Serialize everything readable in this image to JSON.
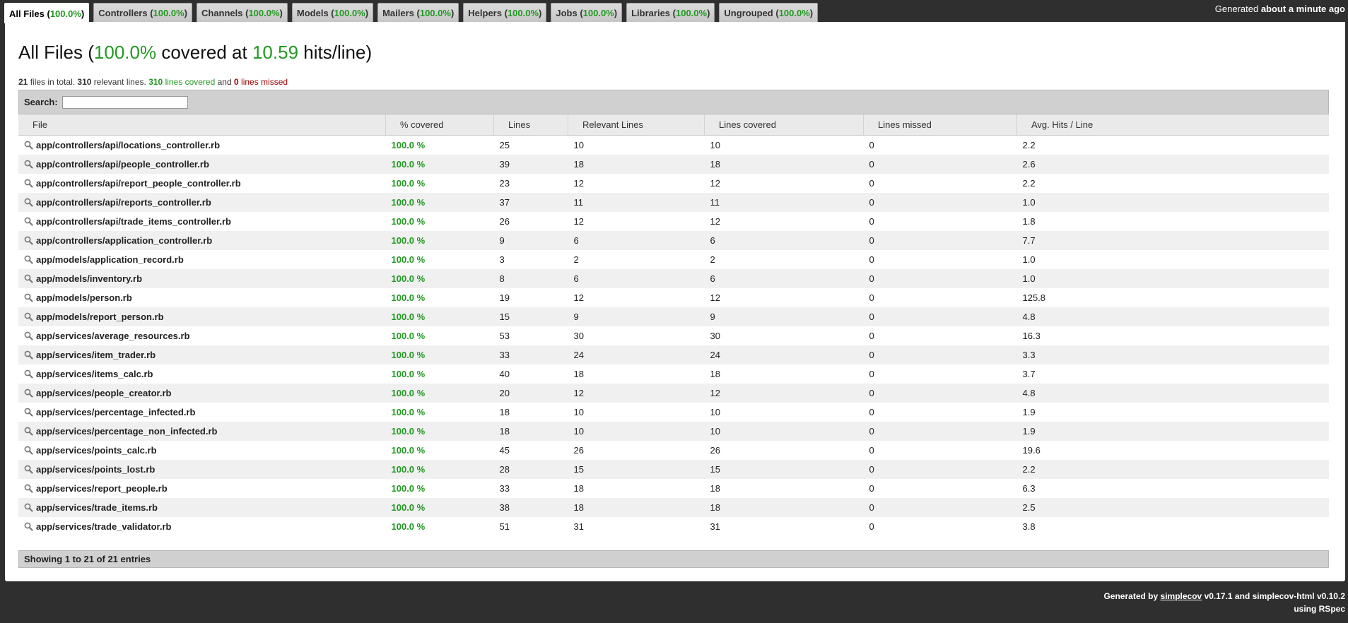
{
  "tabs": [
    {
      "name": "All Files",
      "pct": "100.0%",
      "active": true
    },
    {
      "name": "Controllers",
      "pct": "100.0%"
    },
    {
      "name": "Channels",
      "pct": "100.0%"
    },
    {
      "name": "Models",
      "pct": "100.0%"
    },
    {
      "name": "Mailers",
      "pct": "100.0%"
    },
    {
      "name": "Helpers",
      "pct": "100.0%"
    },
    {
      "name": "Jobs",
      "pct": "100.0%"
    },
    {
      "name": "Libraries",
      "pct": "100.0%"
    },
    {
      "name": "Ungrouped",
      "pct": "100.0%"
    }
  ],
  "timestamp": {
    "prefix": "Generated",
    "value": "about a minute ago"
  },
  "title": {
    "name": "All Files",
    "pct": "100.0%",
    "middle": "covered at",
    "hits": "10.59",
    "suffix": "hits/line"
  },
  "summary": {
    "files": "21",
    "files_text": "files in total.",
    "relevant": "310",
    "relevant_text": "relevant lines.",
    "covered": "310",
    "covered_text": "lines covered",
    "and_text": "and",
    "missed": "0",
    "missed_text": "lines missed"
  },
  "search": {
    "label": "Search:",
    "value": ""
  },
  "table": {
    "headers": [
      "File",
      "% covered",
      "Lines",
      "Relevant Lines",
      "Lines covered",
      "Lines missed",
      "Avg. Hits / Line"
    ],
    "rows": [
      [
        "app/controllers/api/locations_controller.rb",
        "100.0 %",
        "25",
        "10",
        "10",
        "0",
        "2.2"
      ],
      [
        "app/controllers/api/people_controller.rb",
        "100.0 %",
        "39",
        "18",
        "18",
        "0",
        "2.6"
      ],
      [
        "app/controllers/api/report_people_controller.rb",
        "100.0 %",
        "23",
        "12",
        "12",
        "0",
        "2.2"
      ],
      [
        "app/controllers/api/reports_controller.rb",
        "100.0 %",
        "37",
        "11",
        "11",
        "0",
        "1.0"
      ],
      [
        "app/controllers/api/trade_items_controller.rb",
        "100.0 %",
        "26",
        "12",
        "12",
        "0",
        "1.8"
      ],
      [
        "app/controllers/application_controller.rb",
        "100.0 %",
        "9",
        "6",
        "6",
        "0",
        "7.7"
      ],
      [
        "app/models/application_record.rb",
        "100.0 %",
        "3",
        "2",
        "2",
        "0",
        "1.0"
      ],
      [
        "app/models/inventory.rb",
        "100.0 %",
        "8",
        "6",
        "6",
        "0",
        "1.0"
      ],
      [
        "app/models/person.rb",
        "100.0 %",
        "19",
        "12",
        "12",
        "0",
        "125.8"
      ],
      [
        "app/models/report_person.rb",
        "100.0 %",
        "15",
        "9",
        "9",
        "0",
        "4.8"
      ],
      [
        "app/services/average_resources.rb",
        "100.0 %",
        "53",
        "30",
        "30",
        "0",
        "16.3"
      ],
      [
        "app/services/item_trader.rb",
        "100.0 %",
        "33",
        "24",
        "24",
        "0",
        "3.3"
      ],
      [
        "app/services/items_calc.rb",
        "100.0 %",
        "40",
        "18",
        "18",
        "0",
        "3.7"
      ],
      [
        "app/services/people_creator.rb",
        "100.0 %",
        "20",
        "12",
        "12",
        "0",
        "4.8"
      ],
      [
        "app/services/percentage_infected.rb",
        "100.0 %",
        "18",
        "10",
        "10",
        "0",
        "1.9"
      ],
      [
        "app/services/percentage_non_infected.rb",
        "100.0 %",
        "18",
        "10",
        "10",
        "0",
        "1.9"
      ],
      [
        "app/services/points_calc.rb",
        "100.0 %",
        "45",
        "26",
        "26",
        "0",
        "19.6"
      ],
      [
        "app/services/points_lost.rb",
        "100.0 %",
        "28",
        "15",
        "15",
        "0",
        "2.2"
      ],
      [
        "app/services/report_people.rb",
        "100.0 %",
        "33",
        "18",
        "18",
        "0",
        "6.3"
      ],
      [
        "app/services/trade_items.rb",
        "100.0 %",
        "38",
        "18",
        "18",
        "0",
        "2.5"
      ],
      [
        "app/services/trade_validator.rb",
        "100.0 %",
        "51",
        "31",
        "31",
        "0",
        "3.8"
      ]
    ]
  },
  "pager": {
    "text": "Showing 1 to 21 of 21 entries"
  },
  "footer": {
    "generated_by": "Generated by",
    "tool": "simplecov",
    "versions": "v0.17.1 and simplecov-html v0.10.2",
    "using": "using RSpec"
  },
  "colors": {
    "covered_green": "#229922",
    "missed_red": "#a00000",
    "background": "#2f2f2f"
  },
  "icons": {
    "row_icon": "magnifier-icon"
  }
}
